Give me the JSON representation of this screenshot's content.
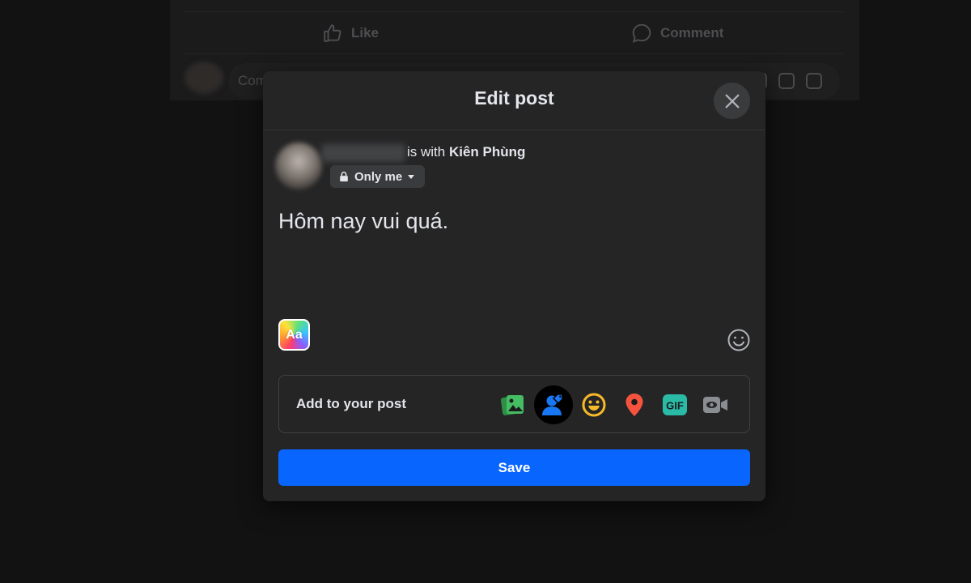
{
  "feed": {
    "like_label": "Like",
    "comment_label": "Comment",
    "comment_placeholder": "Com"
  },
  "modal": {
    "title": "Edit post",
    "author_suffix": "is with ",
    "tagged_person": "Kiên Phùng",
    "privacy_label": "Only me",
    "post_text": "Hôm nay vui quá.",
    "text_style_label": "Aa",
    "add_to_post_label": "Add to your post",
    "add_icons": [
      "photo-video-icon",
      "tag-people-icon",
      "feeling-icon",
      "check-in-icon",
      "gif-icon",
      "live-video-icon"
    ],
    "save_label": "Save"
  },
  "colors": {
    "background": "#121212",
    "modal": "#252526",
    "primary_button": "#0866ff",
    "photo_green": "#45bd62",
    "tag_blue": "#1877f2",
    "feeling_yellow": "#f7b928",
    "checkin_red": "#f5533d",
    "gif_teal": "#2abba7",
    "live_gray": "#8a8d91"
  }
}
